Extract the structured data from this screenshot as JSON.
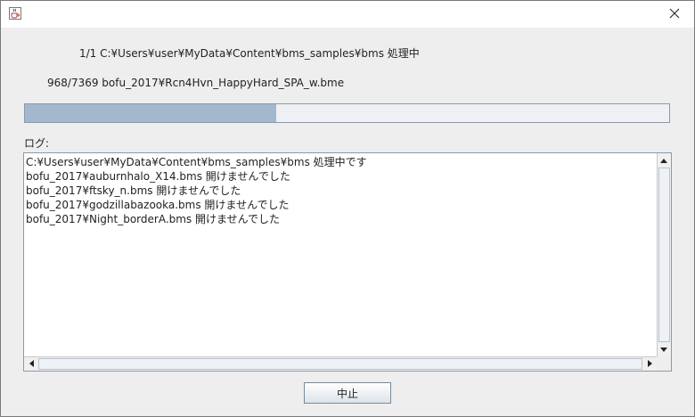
{
  "window": {
    "title": "",
    "icon": "java-cup-icon"
  },
  "status": {
    "overall": "1/1 C:¥Users¥user¥MyData¥Content¥bms_samples¥bms 処理中",
    "current_file": "968/7369 bofu_2017¥Rcn4Hvn_HappyHard_SPA_w.bme",
    "progress_fraction": 0.39
  },
  "log": {
    "label": "ログ:",
    "lines": [
      "C:¥Users¥user¥MyData¥Content¥bms_samples¥bms 処理中です",
      "bofu_2017¥auburnhalo_X14.bms 開けませんでした",
      "bofu_2017¥ftsky_n.bms 開けませんでした",
      "bofu_2017¥godzillabazooka.bms 開けませんでした",
      "bofu_2017¥Night_borderA.bms 開けませんでした"
    ]
  },
  "buttons": {
    "stop_label": "中止"
  },
  "colors": {
    "progress_fill": "#a3b8cf",
    "progress_track": "#eef0f3",
    "window_bg": "#eeeeee"
  }
}
